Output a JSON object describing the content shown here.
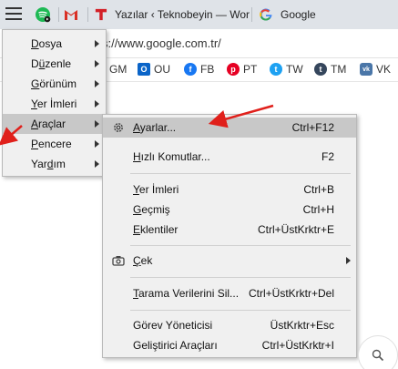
{
  "tabs": [
    {
      "icon": "spotify-icon",
      "title": ""
    },
    {
      "icon": "gmail-icon",
      "title": ""
    },
    {
      "icon": "teknobeyin-icon",
      "title": "Yazılar ‹ Teknobeyin — Wor"
    },
    {
      "icon": "google-icon",
      "title": "Google"
    }
  ],
  "address": {
    "url": "s://www.google.com.tr/"
  },
  "bookmarks": [
    {
      "label": "GM",
      "icon": "gmail-icon",
      "color": "#d93025"
    },
    {
      "label": "OU",
      "icon": "outlook-icon",
      "color": "#0a64c8"
    },
    {
      "label": "FB",
      "icon": "facebook-icon",
      "color": "#1877f2"
    },
    {
      "label": "PT",
      "icon": "pinterest-icon",
      "color": "#e60023"
    },
    {
      "label": "TW",
      "icon": "twitter-icon",
      "color": "#1da1f2"
    },
    {
      "label": "TM",
      "icon": "tumblr-icon",
      "color": "#35465c"
    },
    {
      "label": "VK",
      "icon": "vk-icon",
      "color": "#4a76a8"
    }
  ],
  "main_menu": [
    {
      "pre": "",
      "u": "D",
      "post": "osya"
    },
    {
      "pre": "D",
      "u": "ü",
      "post": "zenle"
    },
    {
      "pre": "",
      "u": "G",
      "post": "örünüm"
    },
    {
      "pre": "",
      "u": "Y",
      "post": "er İmleri"
    },
    {
      "pre": "",
      "u": "A",
      "post": "raçlar"
    },
    {
      "pre": "",
      "u": "P",
      "post": "encere"
    },
    {
      "pre": "Yar",
      "u": "d",
      "post": "ım"
    }
  ],
  "tools_menu": {
    "settings": {
      "pre": "",
      "u": "A",
      "post": "yarlar...",
      "shortcut": "Ctrl+F12"
    },
    "quick_commands": {
      "pre": "",
      "u": "H",
      "post": "ızlı Komutlar...",
      "shortcut": "F2"
    },
    "bookmarks": {
      "pre": "",
      "u": "Y",
      "post": "er İmleri",
      "shortcut": "Ctrl+B"
    },
    "history": {
      "pre": "",
      "u": "G",
      "post": "eçmiş",
      "shortcut": "Ctrl+H"
    },
    "extensions": {
      "pre": "",
      "u": "E",
      "post": "klentiler",
      "shortcut": "Ctrl+ÜstKrktr+E"
    },
    "capture": {
      "pre": "",
      "u": "Ç",
      "post": "ek",
      "shortcut": ""
    },
    "clear_data": {
      "pre": "",
      "u": "T",
      "post": "arama Verilerini Sil...",
      "shortcut": "Ctrl+ÜstKrktr+Del"
    },
    "task_manager": {
      "pre": "Görev Yöneticisi",
      "u": "",
      "post": "",
      "shortcut": "ÜstKrktr+Esc"
    },
    "dev_tools": {
      "pre": "Geliştirici Araçları",
      "u": "",
      "post": "",
      "shortcut": "Ctrl+ÜstKrktr+I"
    }
  },
  "colors": {
    "annotation_arrow": "#e0201b"
  }
}
